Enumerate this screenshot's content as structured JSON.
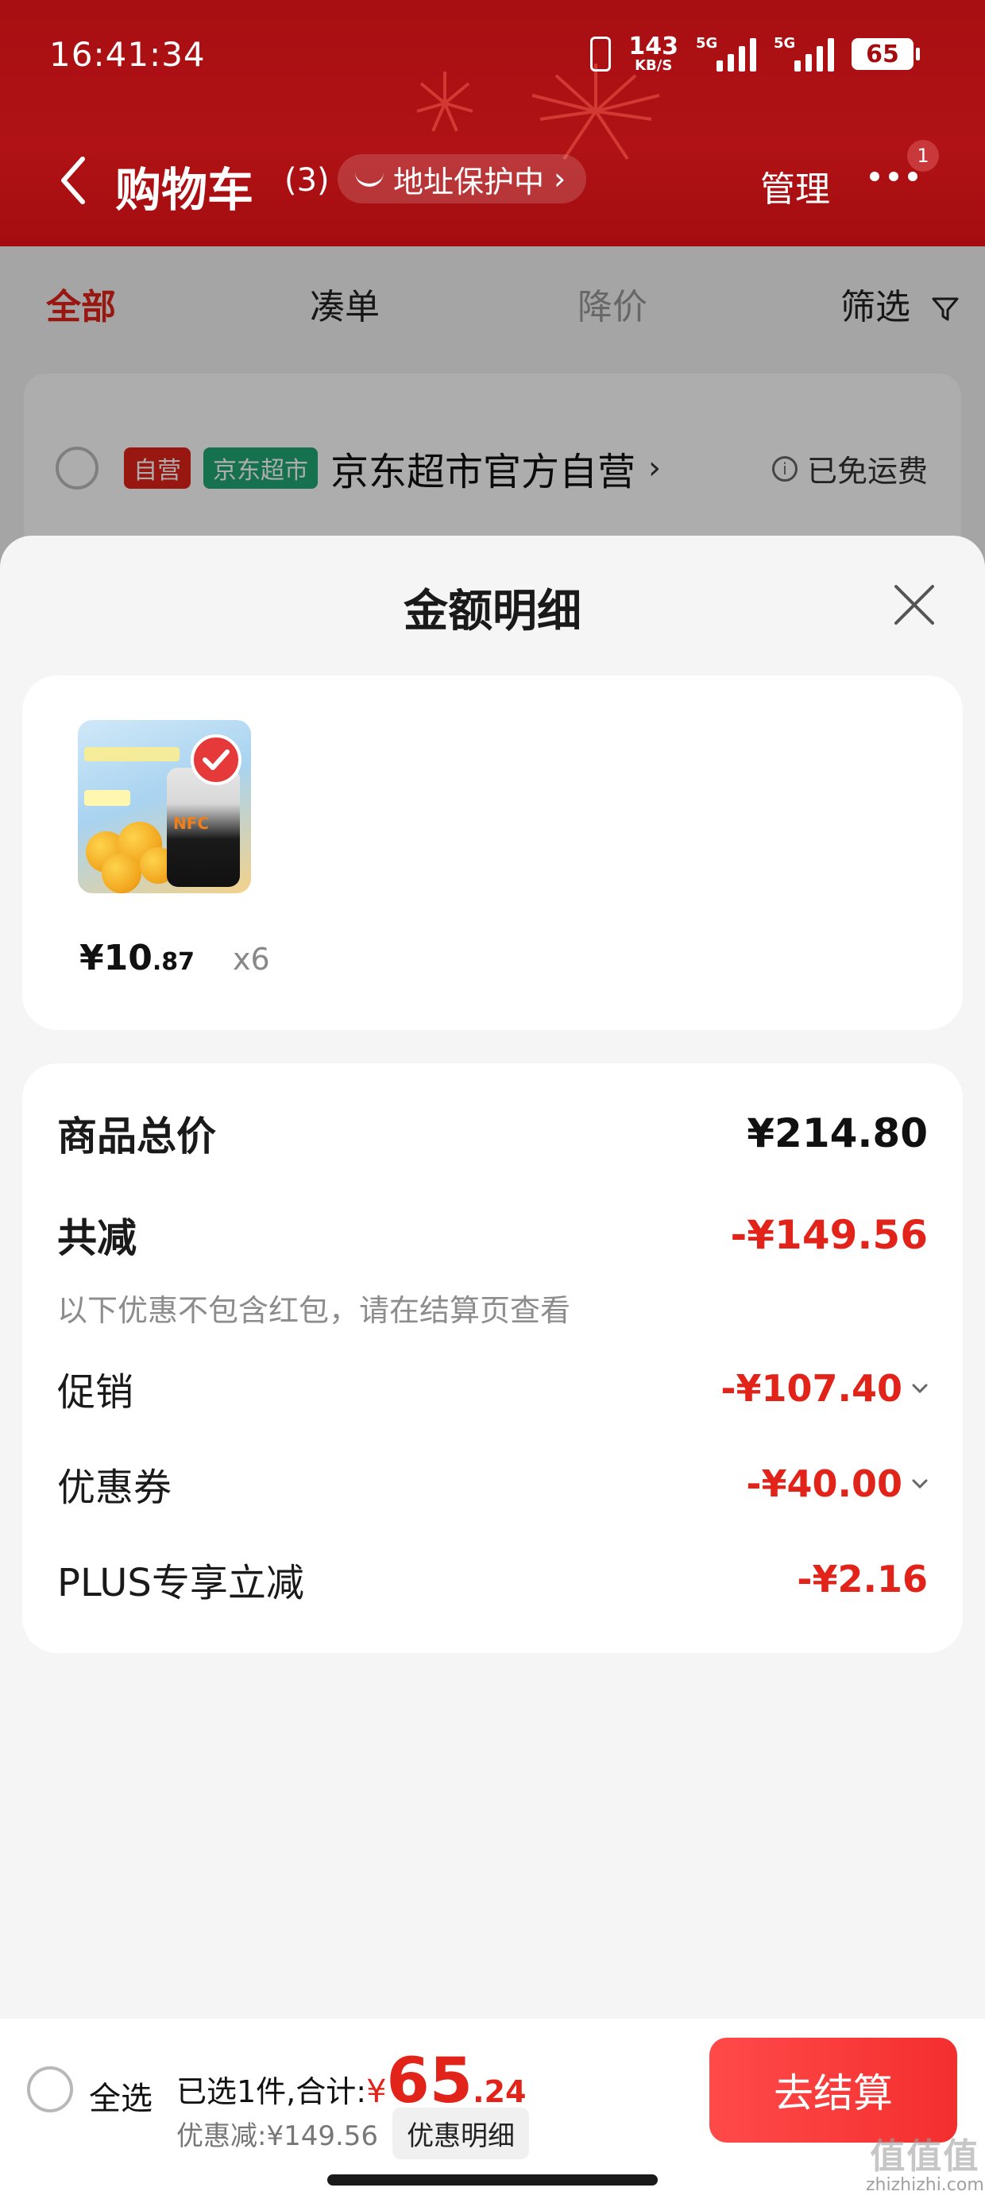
{
  "status_bar": {
    "time": "16:41:34",
    "net_speed": "143",
    "net_unit": "KB/S",
    "sig1_tag": "5G",
    "sig2_tag": "5G",
    "battery": "65"
  },
  "nav": {
    "title": "购物车",
    "count": "(3)",
    "address_protect": "地址保护中",
    "manage": "管理",
    "badge": "1"
  },
  "tabs": {
    "all": "全部",
    "bundle": "凑单",
    "price_drop": "降价",
    "filter": "筛选"
  },
  "store": {
    "tag_self": "自营",
    "tag_super": "京东超市",
    "name": "京东超市官方自营",
    "free_shipping": "已免运费"
  },
  "sheet": {
    "title": "金额明细",
    "product": {
      "price_main": "¥10",
      "price_dec": ".87",
      "qty": "x6"
    },
    "total_label": "商品总价",
    "total_value": "¥214.80",
    "reduce_label": "共减",
    "reduce_value": "-¥149.56",
    "note": "以下优惠不包含红包，请在结算页查看",
    "promo_label": "促销",
    "promo_value": "-¥107.40",
    "coupon_label": "优惠券",
    "coupon_value": "-¥40.00",
    "plus_label": "PLUS专享立减",
    "plus_value": "-¥2.16"
  },
  "checkout": {
    "select_all": "全选",
    "selected_text": "已选1件,合计:",
    "total_symbol": "¥",
    "total_int": "65",
    "total_dec": ".24",
    "discount_text": "优惠减:¥149.56",
    "detail_button": "优惠明细",
    "checkout_button": "去结算"
  },
  "colors": {
    "brand_red": "#e2231a",
    "header_red": "#a80f12",
    "store_green": "#1fa774"
  }
}
